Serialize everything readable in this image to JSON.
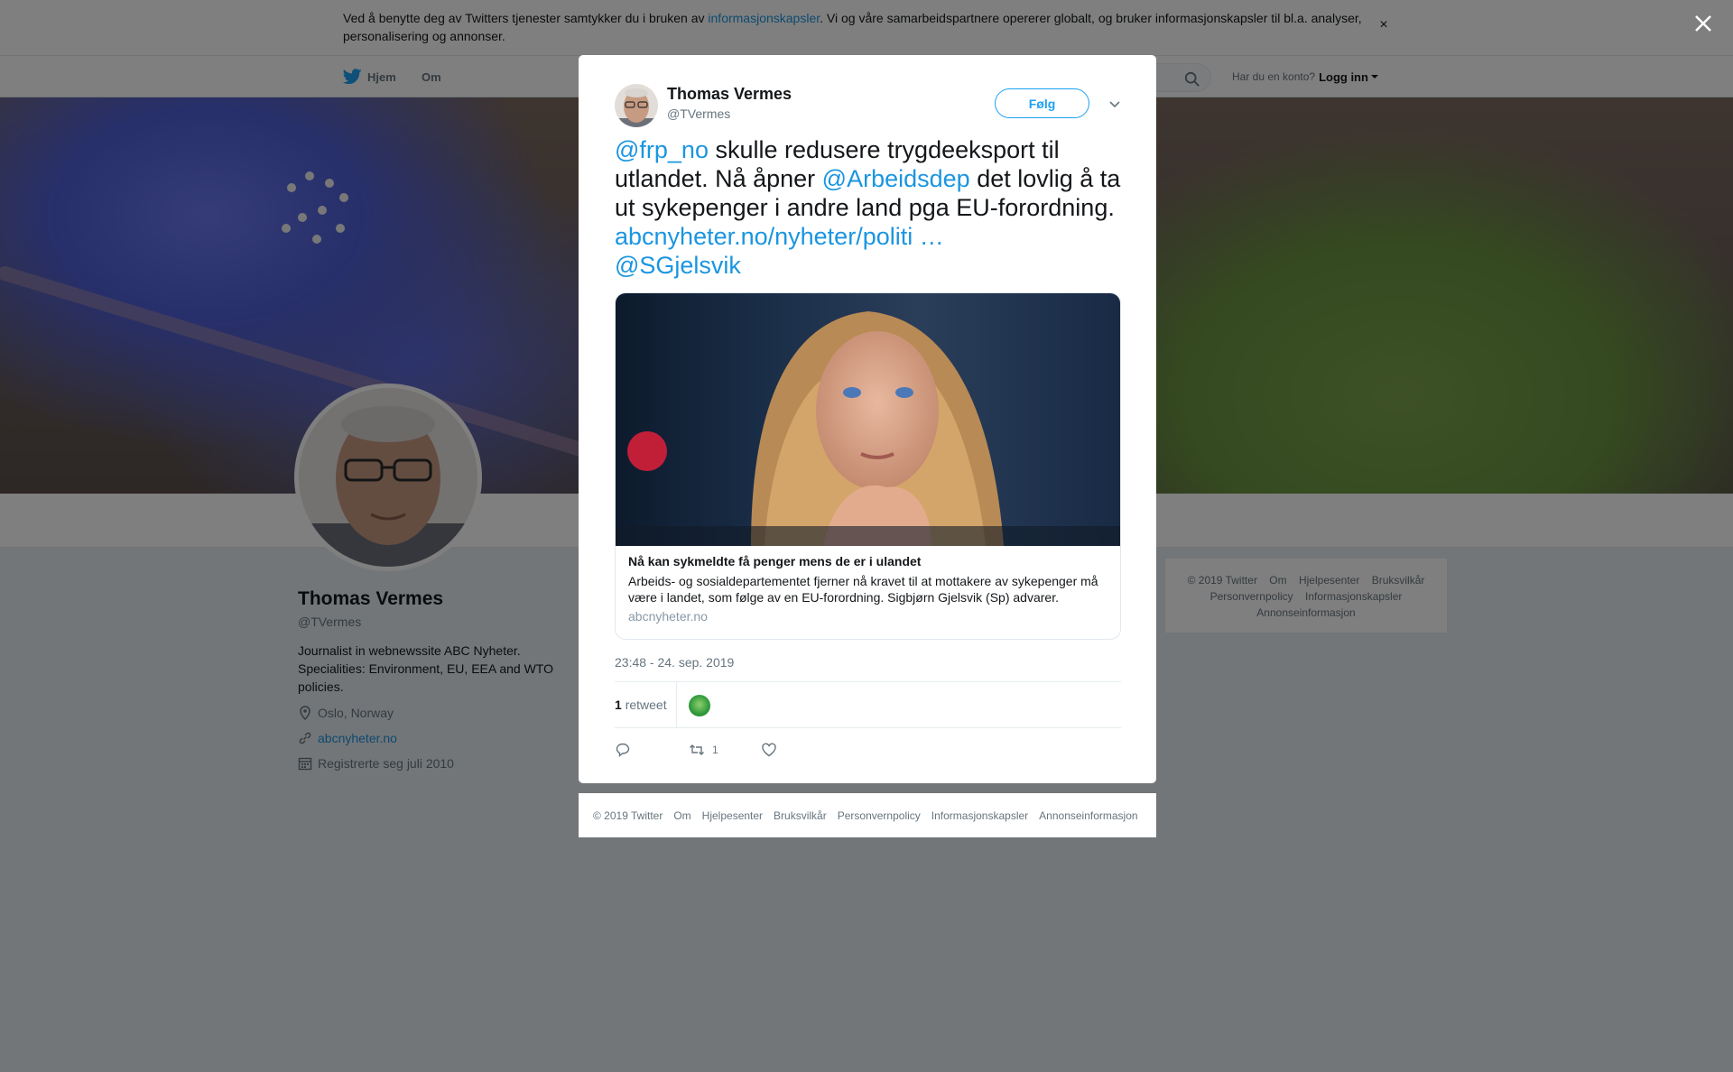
{
  "cookie_banner": {
    "text_before": "Ved å benytte deg av Twitters tjenester samtykker du i bruken av ",
    "link": "informasjonskapsler",
    "text_after": ". Vi og våre samarbeidspartnere opererer globalt, og bruker informasjonskapsler til bl.a. analyser, personalisering og annonser.",
    "close": "×"
  },
  "nav": {
    "home": "Hjem",
    "about": "Om",
    "account_prompt": "Har du en konto?",
    "login": "Logg inn"
  },
  "profile": {
    "name": "Thomas Vermes",
    "handle": "@TVermes",
    "bio": "Journalist in webnewssite ABC Nyheter. Specialities: Environment, EU, EEA and WTO policies.",
    "location": "Oslo, Norway",
    "website": "abcnyheter.no",
    "joined": "Registrerte seg juli 2010"
  },
  "sidebar_footer": {
    "line1": [
      "© 2019 Twitter",
      "Om",
      "Hjelpesenter",
      "Bruksvilkår"
    ],
    "line2": [
      "Personvernpolicy",
      "Informasjonskapsler"
    ],
    "line3": [
      "Annonseinformasjon"
    ]
  },
  "tweet": {
    "author_name": "Thomas Vermes",
    "author_handle": "@TVermes",
    "follow_label": "Følg",
    "text": {
      "mention1": "@frp_no",
      "part1": " skulle redusere trygdeeksport til utlandet. Nå åpner ",
      "mention2": "@Arbeidsdep",
      "part2": " det lovlig å ta ut sykepenger i andre land pga EU-forordning. ",
      "link": "abcnyheter.no/nyheter/politi",
      "ellipsis": "…",
      "mention3": "@SGjelsvik"
    },
    "card": {
      "title": "Nå kan sykmeldte få penger mens de er i ulandet",
      "description": "Arbeids- og sosialdepartementet fjerner nå kravet til at mottakere av sykepenger må være i landet, som følge av en EU-forordning. Sigbjørn Gjelsvik (Sp) advarer.",
      "domain": "abcnyheter.no"
    },
    "timestamp": "23:48 - 24. sep. 2019",
    "retweet_count": "1",
    "retweet_label": "retweet",
    "action_retweet_count": "1"
  },
  "modal_footer": [
    "© 2019 Twitter",
    "Om",
    "Hjelpesenter",
    "Bruksvilkår",
    "Personvernpolicy",
    "Informasjonskapsler",
    "Annonseinformasjon"
  ],
  "icons": {
    "bird": "twitter-bird-icon",
    "search": "search-icon",
    "location": "location-pin-icon",
    "link": "link-icon",
    "calendar": "calendar-icon",
    "reply": "reply-icon",
    "retweet": "retweet-icon",
    "like": "heart-icon",
    "chevron": "chevron-down-icon",
    "close": "close-icon"
  },
  "colors": {
    "link": "#1b95e0",
    "follow": "#1da1f2",
    "muted": "#66757f"
  }
}
